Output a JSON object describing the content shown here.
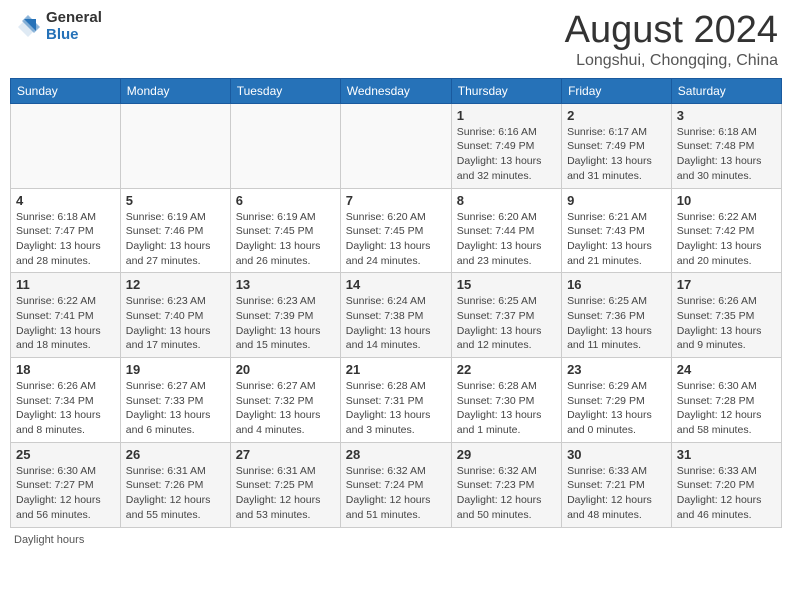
{
  "header": {
    "logo_general": "General",
    "logo_blue": "Blue",
    "title": "August 2024",
    "subtitle": "Longshui, Chongqing, China"
  },
  "weekdays": [
    "Sunday",
    "Monday",
    "Tuesday",
    "Wednesday",
    "Thursday",
    "Friday",
    "Saturday"
  ],
  "weeks": [
    [
      {
        "day": "",
        "info": ""
      },
      {
        "day": "",
        "info": ""
      },
      {
        "day": "",
        "info": ""
      },
      {
        "day": "",
        "info": ""
      },
      {
        "day": "1",
        "info": "Sunrise: 6:16 AM\nSunset: 7:49 PM\nDaylight: 13 hours\nand 32 minutes."
      },
      {
        "day": "2",
        "info": "Sunrise: 6:17 AM\nSunset: 7:49 PM\nDaylight: 13 hours\nand 31 minutes."
      },
      {
        "day": "3",
        "info": "Sunrise: 6:18 AM\nSunset: 7:48 PM\nDaylight: 13 hours\nand 30 minutes."
      }
    ],
    [
      {
        "day": "4",
        "info": "Sunrise: 6:18 AM\nSunset: 7:47 PM\nDaylight: 13 hours\nand 28 minutes."
      },
      {
        "day": "5",
        "info": "Sunrise: 6:19 AM\nSunset: 7:46 PM\nDaylight: 13 hours\nand 27 minutes."
      },
      {
        "day": "6",
        "info": "Sunrise: 6:19 AM\nSunset: 7:45 PM\nDaylight: 13 hours\nand 26 minutes."
      },
      {
        "day": "7",
        "info": "Sunrise: 6:20 AM\nSunset: 7:45 PM\nDaylight: 13 hours\nand 24 minutes."
      },
      {
        "day": "8",
        "info": "Sunrise: 6:20 AM\nSunset: 7:44 PM\nDaylight: 13 hours\nand 23 minutes."
      },
      {
        "day": "9",
        "info": "Sunrise: 6:21 AM\nSunset: 7:43 PM\nDaylight: 13 hours\nand 21 minutes."
      },
      {
        "day": "10",
        "info": "Sunrise: 6:22 AM\nSunset: 7:42 PM\nDaylight: 13 hours\nand 20 minutes."
      }
    ],
    [
      {
        "day": "11",
        "info": "Sunrise: 6:22 AM\nSunset: 7:41 PM\nDaylight: 13 hours\nand 18 minutes."
      },
      {
        "day": "12",
        "info": "Sunrise: 6:23 AM\nSunset: 7:40 PM\nDaylight: 13 hours\nand 17 minutes."
      },
      {
        "day": "13",
        "info": "Sunrise: 6:23 AM\nSunset: 7:39 PM\nDaylight: 13 hours\nand 15 minutes."
      },
      {
        "day": "14",
        "info": "Sunrise: 6:24 AM\nSunset: 7:38 PM\nDaylight: 13 hours\nand 14 minutes."
      },
      {
        "day": "15",
        "info": "Sunrise: 6:25 AM\nSunset: 7:37 PM\nDaylight: 13 hours\nand 12 minutes."
      },
      {
        "day": "16",
        "info": "Sunrise: 6:25 AM\nSunset: 7:36 PM\nDaylight: 13 hours\nand 11 minutes."
      },
      {
        "day": "17",
        "info": "Sunrise: 6:26 AM\nSunset: 7:35 PM\nDaylight: 13 hours\nand 9 minutes."
      }
    ],
    [
      {
        "day": "18",
        "info": "Sunrise: 6:26 AM\nSunset: 7:34 PM\nDaylight: 13 hours\nand 8 minutes."
      },
      {
        "day": "19",
        "info": "Sunrise: 6:27 AM\nSunset: 7:33 PM\nDaylight: 13 hours\nand 6 minutes."
      },
      {
        "day": "20",
        "info": "Sunrise: 6:27 AM\nSunset: 7:32 PM\nDaylight: 13 hours\nand 4 minutes."
      },
      {
        "day": "21",
        "info": "Sunrise: 6:28 AM\nSunset: 7:31 PM\nDaylight: 13 hours\nand 3 minutes."
      },
      {
        "day": "22",
        "info": "Sunrise: 6:28 AM\nSunset: 7:30 PM\nDaylight: 13 hours\nand 1 minute."
      },
      {
        "day": "23",
        "info": "Sunrise: 6:29 AM\nSunset: 7:29 PM\nDaylight: 13 hours\nand 0 minutes."
      },
      {
        "day": "24",
        "info": "Sunrise: 6:30 AM\nSunset: 7:28 PM\nDaylight: 12 hours\nand 58 minutes."
      }
    ],
    [
      {
        "day": "25",
        "info": "Sunrise: 6:30 AM\nSunset: 7:27 PM\nDaylight: 12 hours\nand 56 minutes."
      },
      {
        "day": "26",
        "info": "Sunrise: 6:31 AM\nSunset: 7:26 PM\nDaylight: 12 hours\nand 55 minutes."
      },
      {
        "day": "27",
        "info": "Sunrise: 6:31 AM\nSunset: 7:25 PM\nDaylight: 12 hours\nand 53 minutes."
      },
      {
        "day": "28",
        "info": "Sunrise: 6:32 AM\nSunset: 7:24 PM\nDaylight: 12 hours\nand 51 minutes."
      },
      {
        "day": "29",
        "info": "Sunrise: 6:32 AM\nSunset: 7:23 PM\nDaylight: 12 hours\nand 50 minutes."
      },
      {
        "day": "30",
        "info": "Sunrise: 6:33 AM\nSunset: 7:21 PM\nDaylight: 12 hours\nand 48 minutes."
      },
      {
        "day": "31",
        "info": "Sunrise: 6:33 AM\nSunset: 7:20 PM\nDaylight: 12 hours\nand 46 minutes."
      }
    ]
  ],
  "footer": {
    "daylight_label": "Daylight hours"
  }
}
